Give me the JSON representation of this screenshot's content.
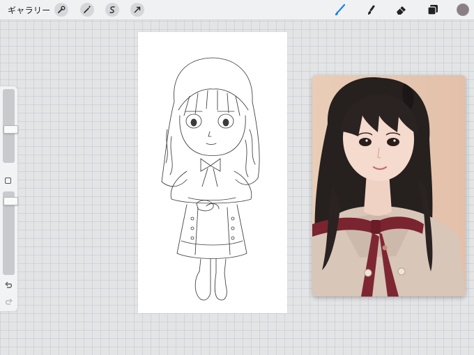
{
  "topbar": {
    "gallery_label": "ギャラリー",
    "tools_left": [
      "wrench-icon",
      "magic-wand-icon",
      "selection-icon",
      "transform-arrow-icon"
    ],
    "tools_right": [
      "brush-icon",
      "smudge-icon",
      "eraser-icon",
      "layers-icon"
    ],
    "active_tool": "brush-icon",
    "active_color": "#8b7f86",
    "accent_color": "#1e7ef0"
  },
  "sidebar": {
    "brush_size_level": 0.45,
    "opacity_level": 0.93,
    "buttons": [
      "modify-button",
      "undo-icon",
      "redo-icon"
    ]
  }
}
